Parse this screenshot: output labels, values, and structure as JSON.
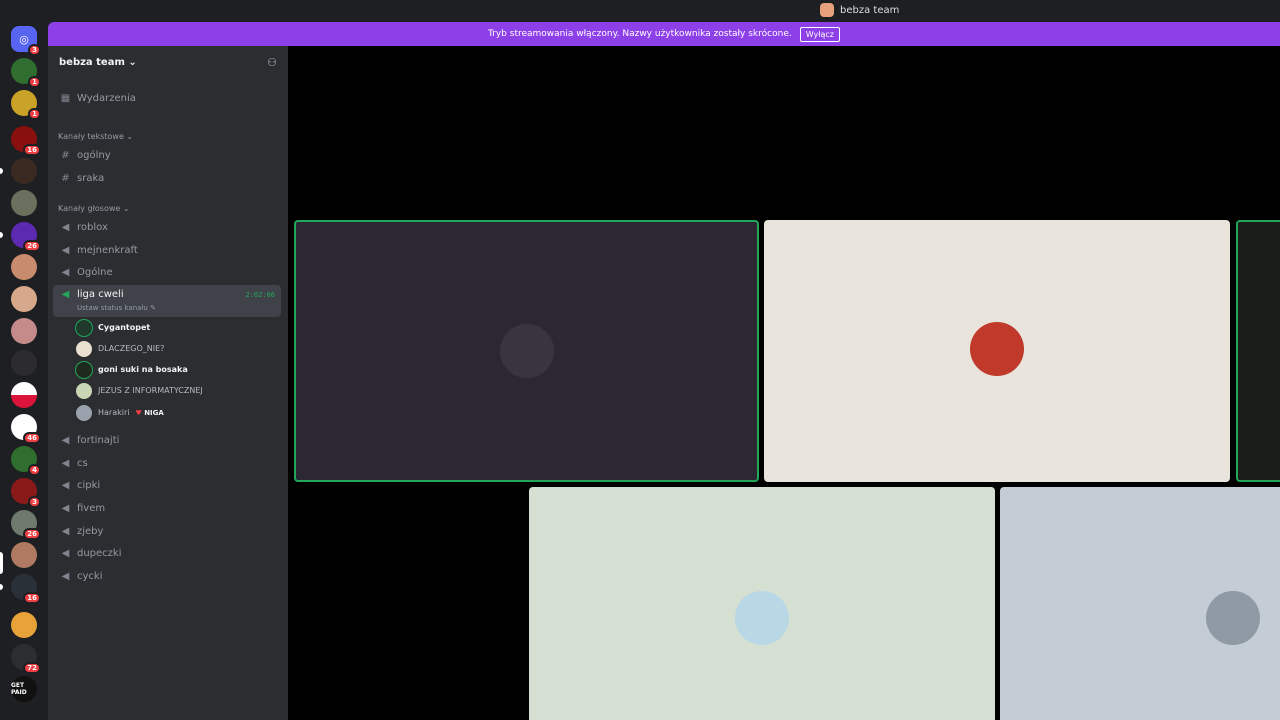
{
  "window": {
    "title": "bebza team"
  },
  "banner": {
    "text": "Tryb streamowania włączony. Nazwy użytkownika zostały skrócone.",
    "button": "Wyłącz"
  },
  "server": {
    "name": "bebza team"
  },
  "events_label": "Wydarzenia",
  "text_category": "Kanały tekstowe",
  "text_channels": [
    "ogólny",
    "sraka"
  ],
  "voice_category": "Kanały głosowe",
  "voice_channels_top": [
    "roblox",
    "mejnenkraft",
    "Ogólne"
  ],
  "active_channel": {
    "name": "liga cweli",
    "timer": "2:02:06",
    "status": "Ustaw status kanału"
  },
  "voice_users": [
    {
      "name": "Cygantopet",
      "tag": ""
    },
    {
      "name": "DLACZEGO_NIE?",
      "tag": ""
    },
    {
      "name": "goni suki na bosaka",
      "tag": ""
    },
    {
      "name": "JEZUS Z INFORMATYCZNEJ",
      "tag": ""
    },
    {
      "name": "Harakiri",
      "tag": "NIGA"
    }
  ],
  "voice_channels_bottom": [
    "fortinajti",
    "cs",
    "cipki",
    "fivem",
    "zjeby",
    "dupeczki",
    "cycki"
  ],
  "guild_badges": [
    "3",
    "1",
    "1",
    "16",
    "26",
    "46",
    "4",
    "3",
    "26",
    "16",
    "72"
  ],
  "guild_folder_label": "GET PAID",
  "colors": {
    "banner": "#8d3fe8",
    "speaking": "#23a55a",
    "sidebar": "#2b2d31",
    "rail": "#1e1f22"
  },
  "icons": {
    "hash": "hash-icon",
    "speaker": "speaker-icon",
    "calendar": "calendar-icon",
    "add_member": "add-member-icon",
    "chevron": "chevron-down-icon",
    "pencil": "pencil-icon"
  }
}
